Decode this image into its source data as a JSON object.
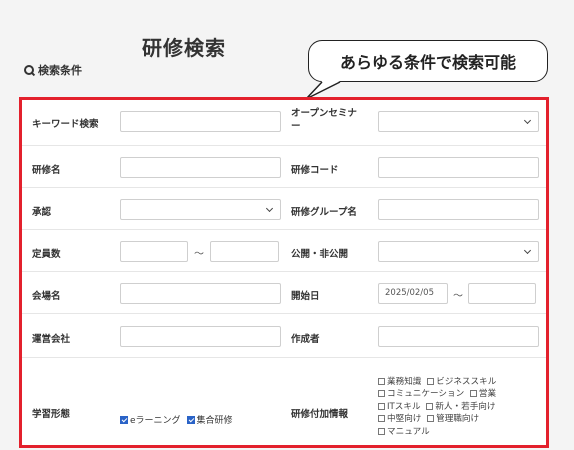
{
  "header": {
    "title": "研修検索",
    "search_conditions": "検索条件",
    "callout": "あらゆる条件で検索可能"
  },
  "form": {
    "keyword": {
      "label": "キーワード検索",
      "value": ""
    },
    "open_seminar": {
      "label": "オープンセミナー",
      "value": ""
    },
    "training_name": {
      "label": "研修名",
      "value": ""
    },
    "training_code": {
      "label": "研修コード",
      "value": ""
    },
    "approval": {
      "label": "承認",
      "value": ""
    },
    "training_group_name": {
      "label": "研修グループ名",
      "value": ""
    },
    "capacity": {
      "label": "定員数",
      "from": "",
      "to": "",
      "separator": "～"
    },
    "visibility": {
      "label": "公開・非公開",
      "value": ""
    },
    "venue_name": {
      "label": "会場名",
      "value": ""
    },
    "start_date": {
      "label": "開始日",
      "from": "2025/02/05",
      "to": "",
      "separator": "～"
    },
    "operating_company": {
      "label": "運営会社",
      "value": ""
    },
    "creator": {
      "label": "作成者",
      "value": ""
    },
    "learning_mode": {
      "label": "学習形態",
      "options": [
        {
          "label": "eラーニング",
          "checked": true
        },
        {
          "label": "集合研修",
          "checked": true
        }
      ]
    },
    "training_tags": {
      "label": "研修付加情報",
      "options": [
        {
          "label": "業務知識",
          "checked": false
        },
        {
          "label": "ビジネススキル",
          "checked": false
        },
        {
          "label": "コミュニケーション",
          "checked": false
        },
        {
          "label": "営業",
          "checked": false
        },
        {
          "label": "ITスキル",
          "checked": false
        },
        {
          "label": "新人・若手向け",
          "checked": false
        },
        {
          "label": "中堅向け",
          "checked": false
        },
        {
          "label": "管理職向け",
          "checked": false
        },
        {
          "label": "マニュアル",
          "checked": false
        }
      ]
    }
  },
  "colors": {
    "frame": "#e3202c",
    "checkbox_checked": "#2a63c7",
    "page_bg": "#f4f4f4"
  }
}
